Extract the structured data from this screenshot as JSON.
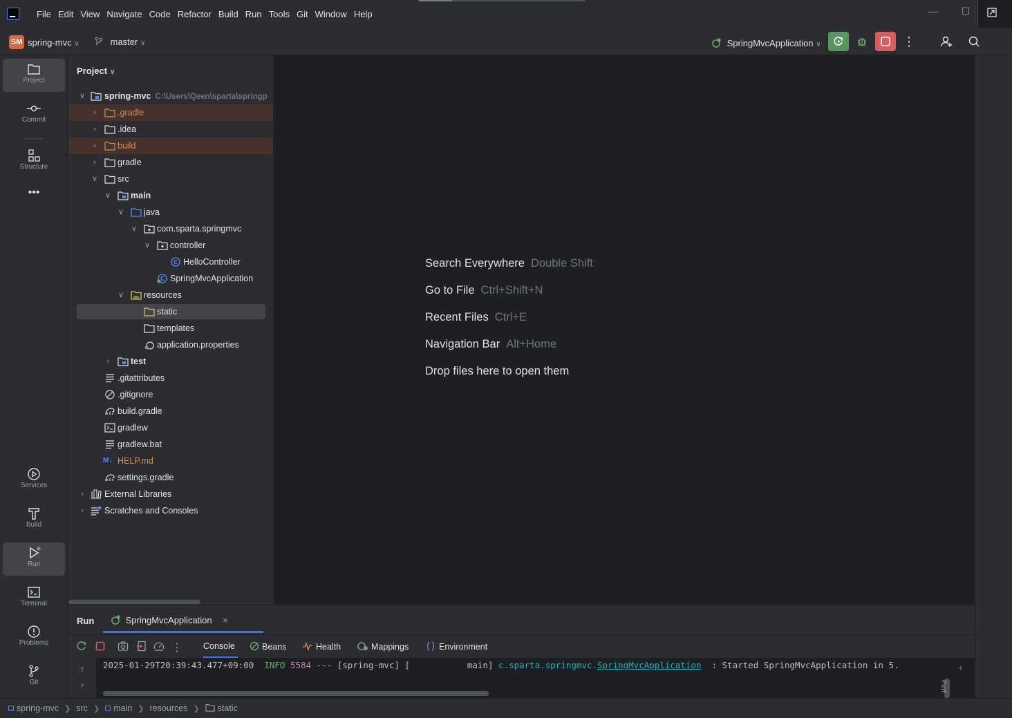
{
  "menubar": {
    "items": [
      "File",
      "Edit",
      "View",
      "Navigate",
      "Code",
      "Refactor",
      "Build",
      "Run",
      "Tools",
      "Git",
      "Window",
      "Help"
    ]
  },
  "toolbar": {
    "project_badge": "SM",
    "project_name": "spring-mvc",
    "branch": "master",
    "run_config": "SpringMvcApplication"
  },
  "stripe": {
    "top": [
      {
        "label": "Project",
        "icon": "folder-icon"
      },
      {
        "label": "Commit",
        "icon": "commit-icon"
      },
      {
        "label": "Structure",
        "icon": "structure-icon"
      }
    ],
    "bottom": [
      {
        "label": "Services",
        "icon": "services-icon"
      },
      {
        "label": "Build",
        "icon": "hammer-icon"
      },
      {
        "label": "Run",
        "icon": "run-icon"
      },
      {
        "label": "Terminal",
        "icon": "terminal-icon"
      },
      {
        "label": "Problems",
        "icon": "problems-icon"
      },
      {
        "label": "Git",
        "icon": "git-icon"
      }
    ]
  },
  "project_panel": {
    "title": "Project",
    "root_path": "C:\\Users\\Qeen\\sparta\\springp",
    "tree": [
      {
        "label": "spring-mvc",
        "bold": true
      },
      {
        "label": ".gradle"
      },
      {
        "label": ".idea"
      },
      {
        "label": "build"
      },
      {
        "label": "gradle"
      },
      {
        "label": "src"
      },
      {
        "label": "main",
        "bold": true
      },
      {
        "label": "java"
      },
      {
        "label": "com.sparta.springmvc"
      },
      {
        "label": "controller"
      },
      {
        "label": "HelloController"
      },
      {
        "label": "SpringMvcApplication"
      },
      {
        "label": "resources"
      },
      {
        "label": "static"
      },
      {
        "label": "templates"
      },
      {
        "label": "application.properties"
      },
      {
        "label": "test",
        "bold": true
      },
      {
        "label": ".gitattributes"
      },
      {
        "label": ".gitignore"
      },
      {
        "label": "build.gradle"
      },
      {
        "label": "gradlew"
      },
      {
        "label": "gradlew.bat"
      },
      {
        "label": "HELP.md"
      },
      {
        "label": "settings.gradle"
      },
      {
        "label": "External Libraries"
      },
      {
        "label": "Scratches and Consoles"
      }
    ]
  },
  "editor": {
    "hints": [
      {
        "action": "Search Everywhere",
        "key": "Double Shift"
      },
      {
        "action": "Go to File",
        "key": "Ctrl+Shift+N"
      },
      {
        "action": "Recent Files",
        "key": "Ctrl+E"
      },
      {
        "action": "Navigation Bar",
        "key": "Alt+Home"
      },
      {
        "action": "Drop files here to open them",
        "key": ""
      }
    ]
  },
  "run_panel": {
    "title": "Run",
    "tab": "SpringMvcApplication",
    "tabs": [
      "Console",
      "Beans",
      "Health",
      "Mappings",
      "Environment"
    ],
    "log": {
      "timestamp": "2025-01-29T20:39:43.477+09:00",
      "level": "INFO",
      "pid": "5584",
      "sep": "---",
      "app": "[spring-mvc]",
      "thread": "[           main]",
      "logger_pkg": "c.sparta.springmvc.",
      "logger_class": "SpringMvcApplication",
      "message": " : Started SpringMvcApplication in 5."
    },
    "side_label": "Perf"
  },
  "statusbar": {
    "crumbs": [
      "spring-mvc",
      "src",
      "main",
      "resources",
      "static"
    ]
  },
  "colors": {
    "accent": "#3574f0",
    "run_green": "#57965c",
    "stop_red": "#db5c5c",
    "excluded_bg": "#45322b",
    "badge": "#d9683f"
  }
}
